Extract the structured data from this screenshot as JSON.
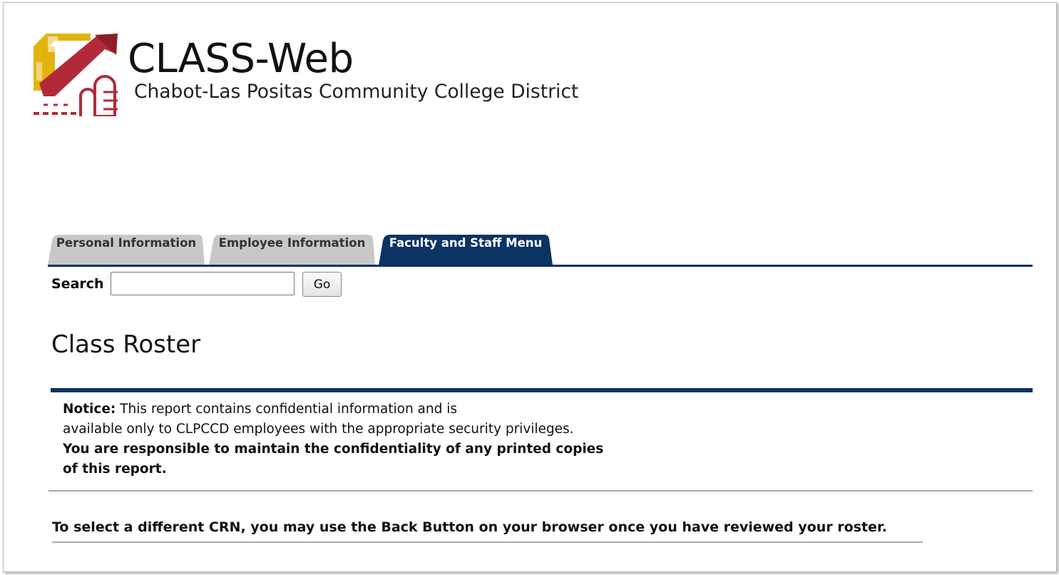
{
  "header": {
    "app_title": "CLASS-Web",
    "subtitle": "Chabot-Las Positas Community College District",
    "logo_icon": "clpccd-logo-icon"
  },
  "tabs": [
    {
      "label": "Personal Information",
      "active": false
    },
    {
      "label": "Employee Information",
      "active": false
    },
    {
      "label": "Faculty and Staff Menu",
      "active": true
    }
  ],
  "search": {
    "label": "Search",
    "value": "",
    "placeholder": "",
    "button_label": "Go"
  },
  "page": {
    "title": "Class Roster"
  },
  "notice": {
    "heading": "Notice:",
    "line1_rest": " This report contains confidential information and is",
    "line2": "available only to CLPCCD employees with the appropriate security privileges.",
    "line3": "You are responsible to maintain the confidentiality of any printed copies",
    "line4": "of this report."
  },
  "footer_note": "To select a different CRN, you may use the Back Button on your browser once you have reviewed your roster.",
  "colors": {
    "tab_active": "#0b3363",
    "tab_inactive": "#c8c8c8",
    "rule": "#0b3363",
    "logo_red": "#b22a3a",
    "logo_gold": "#e3b40e"
  }
}
